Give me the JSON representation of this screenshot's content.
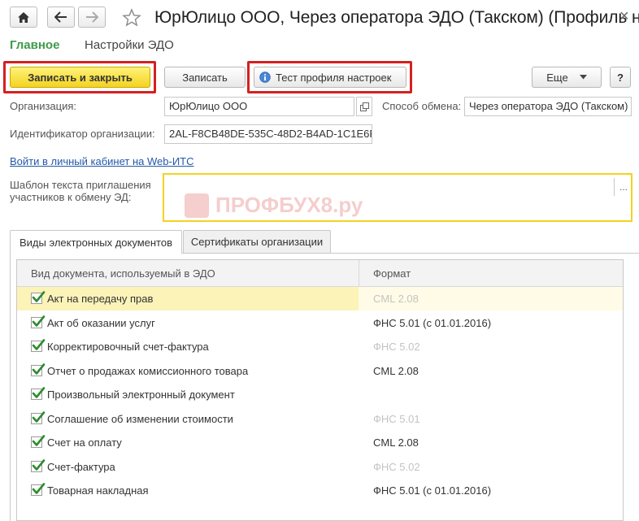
{
  "window": {
    "title": "ЮрЮлицо ООО, Через оператора ЭДО (Такском) (Профиль н...",
    "close_glyph": "×"
  },
  "nav": {
    "home_icon": "home-icon",
    "back_icon": "arrow-left-icon",
    "forward_icon": "arrow-right-icon",
    "favorite_icon": "star-icon"
  },
  "subnav": {
    "main": "Главное",
    "settings": "Настройки ЭДО"
  },
  "toolbar": {
    "save_close": "Записать и закрыть",
    "save": "Записать",
    "test": "Тест профиля настроек",
    "more": "Еще",
    "help": "?"
  },
  "form": {
    "org_label": "Организация:",
    "org_value": "ЮрЮлицо ООО",
    "exchange_label": "Способ обмена:",
    "exchange_value": "Через оператора ЭДО (Такском)",
    "id_label": "Идентификатор организации:",
    "id_value": "2AL-F8CB48DE-535C-48D2-B4AD-1C1E6F",
    "web_link": "Войти в личный кабинет на Web-ИТС",
    "template_label_1": "Шаблон текста приглашения",
    "template_label_2": "участников к обмену ЭД:",
    "template_value": "",
    "ellipsis": "..."
  },
  "watermark": {
    "text": "ПРОФБУХ8.ру"
  },
  "tabs": [
    {
      "label": "Виды электронных документов",
      "active": true
    },
    {
      "label": "Сертификаты организации",
      "active": false
    }
  ],
  "table": {
    "col_doc": "Вид документа, используемый в ЭДО",
    "col_format": "Формат",
    "rows": [
      {
        "doc": "Акт на передачу прав",
        "format": "CML 2.08",
        "checked": true,
        "selected": true,
        "muted": true
      },
      {
        "doc": "Акт об оказании услуг",
        "format": "ФНС 5.01 (с 01.01.2016)",
        "checked": true,
        "selected": false,
        "muted": false
      },
      {
        "doc": "Корректировочный счет-фактура",
        "format": "ФНС 5.02",
        "checked": true,
        "selected": false,
        "muted": true
      },
      {
        "doc": "Отчет о продажах комиссионного товара",
        "format": "CML 2.08",
        "checked": true,
        "selected": false,
        "muted": false
      },
      {
        "doc": "Произвольный электронный документ",
        "format": "",
        "checked": true,
        "selected": false,
        "muted": false
      },
      {
        "doc": "Соглашение об изменении стоимости",
        "format": "ФНС 5.01",
        "checked": true,
        "selected": false,
        "muted": true
      },
      {
        "doc": "Счет на оплату",
        "format": "CML 2.08",
        "checked": true,
        "selected": false,
        "muted": false
      },
      {
        "doc": "Счет-фактура",
        "format": "ФНС 5.02",
        "checked": true,
        "selected": false,
        "muted": true
      },
      {
        "doc": "Товарная накладная",
        "format": "ФНС 5.01 (с 01.01.2016)",
        "checked": true,
        "selected": false,
        "muted": false
      }
    ]
  },
  "colors": {
    "accent_green": "#3d9a4a",
    "primary_yellow": "#f3d320",
    "highlight_red": "#d42020",
    "link_blue": "#2458a8",
    "check_green": "#2e8b2e"
  }
}
